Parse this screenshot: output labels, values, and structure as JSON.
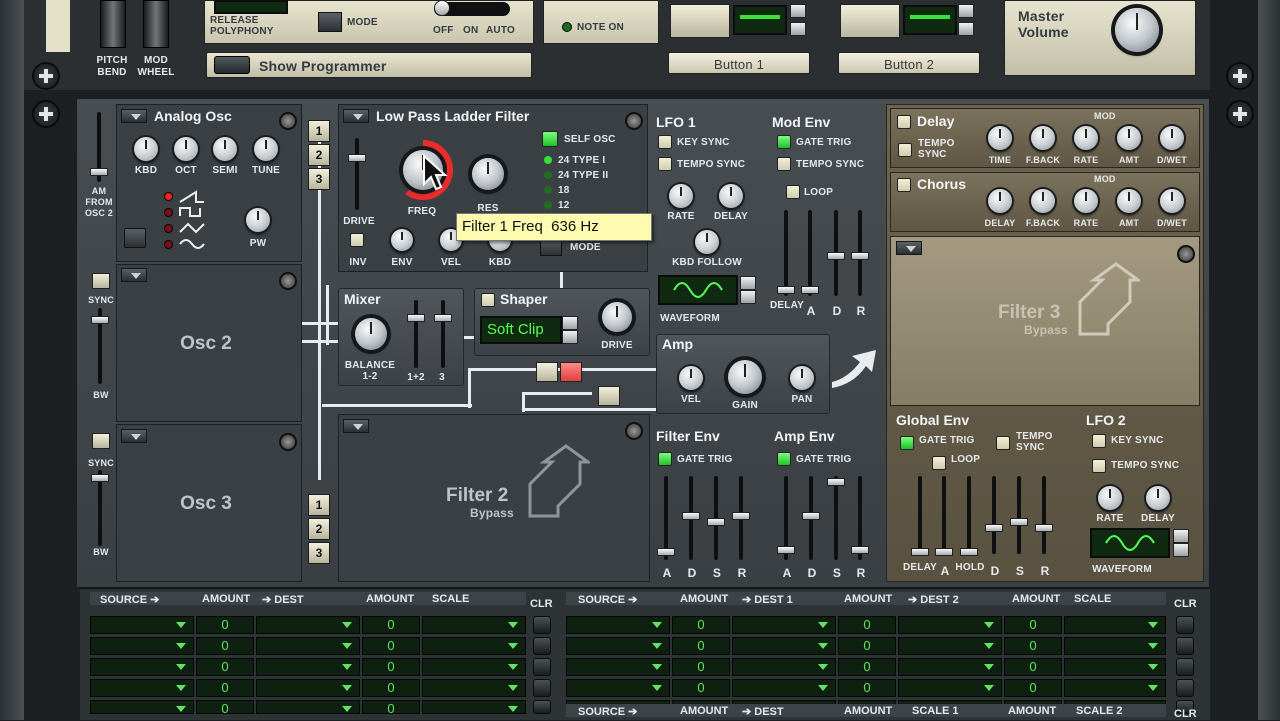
{
  "top": {
    "pitch_bend": "PITCH BEND",
    "mod_wheel": "MOD WHEEL",
    "release_polyphony": "RELEASE POLYPHONY",
    "mode": "MODE",
    "portamento_off": "OFF",
    "portamento_on": "ON",
    "portamento_auto": "AUTO",
    "note_on": "NOTE ON",
    "show_programmer": "Show Programmer",
    "button1": "Button 1",
    "button2": "Button 2",
    "master_volume": "Master Volume"
  },
  "osc1": {
    "title": "Analog Osc",
    "kbd": "KBD",
    "oct": "OCT",
    "semi": "SEMI",
    "tune": "TUNE",
    "pw": "PW",
    "am_from": "AM FROM OSC 2",
    "sync": "SYNC",
    "bw": "BW"
  },
  "osc2": {
    "title": "Osc 2",
    "sync": "SYNC",
    "bw": "BW"
  },
  "osc3": {
    "title": "Osc 3"
  },
  "filter1": {
    "title": "Low Pass Ladder Filter",
    "self_osc": "SELF OSC",
    "types": [
      "24 TYPE I",
      "24 TYPE II",
      "18",
      "12"
    ],
    "drive": "DRIVE",
    "freq": "FREQ",
    "res": "RES",
    "inv": "INV",
    "env": "ENV",
    "vel": "VEL",
    "kbd": "KBD",
    "mode": "MODE",
    "tooltip": "Filter 1 Freq  636 Hz"
  },
  "routing": {
    "n1": "1",
    "n2": "2",
    "n3": "3"
  },
  "mixer": {
    "title": "Mixer",
    "balance": "BALANCE 1-2",
    "ch12": "1+2",
    "ch3": "3"
  },
  "shaper": {
    "title": "Shaper",
    "mode": "Soft Clip",
    "drive": "DRIVE"
  },
  "filter2": {
    "title": "Filter 2",
    "bypass": "Bypass"
  },
  "filter3": {
    "title": "Filter 3",
    "bypass": "Bypass"
  },
  "amp": {
    "title": "Amp",
    "vel": "VEL",
    "gain": "GAIN",
    "pan": "PAN"
  },
  "lfo1": {
    "title": "LFO 1",
    "key_sync": "KEY SYNC",
    "tempo_sync": "TEMPO SYNC",
    "rate": "RATE",
    "delay": "DELAY",
    "kbd_follow": "KBD FOLLOW",
    "waveform": "WAVEFORM"
  },
  "mod_env": {
    "title": "Mod Env",
    "gate_trig": "GATE TRIG",
    "tempo_sync": "TEMPO SYNC",
    "loop": "LOOP",
    "delay": "DELAY",
    "a": "A",
    "d": "D",
    "r": "R"
  },
  "filter_env": {
    "title": "Filter Env",
    "gate_trig": "GATE TRIG",
    "a": "A",
    "d": "D",
    "s": "S",
    "r": "R"
  },
  "amp_env": {
    "title": "Amp Env",
    "gate_trig": "GATE TRIG",
    "a": "A",
    "d": "D",
    "s": "S",
    "r": "R"
  },
  "delay_fx": {
    "title": "Delay",
    "tempo_sync": "TEMPO SYNC",
    "time": "TIME",
    "fback": "F.BACK",
    "rate": "RATE",
    "amt": "AMT",
    "dwet": "D/WET",
    "mod": "MOD"
  },
  "chorus_fx": {
    "title": "Chorus",
    "delay": "DELAY",
    "fback": "F.BACK",
    "rate": "RATE",
    "amt": "AMT",
    "dwet": "D/WET",
    "mod": "MOD"
  },
  "global_env": {
    "title": "Global Env",
    "gate_trig": "GATE TRIG",
    "tempo_sync": "TEMPO SYNC",
    "loop": "LOOP",
    "delay": "DELAY",
    "a": "A",
    "hold": "HOLD",
    "d": "D",
    "s": "S",
    "r": "R"
  },
  "lfo2": {
    "title": "LFO 2",
    "key_sync": "KEY SYNC",
    "tempo_sync": "TEMPO SYNC",
    "rate": "RATE",
    "delay": "DELAY",
    "waveform": "WAVEFORM"
  },
  "mod_bus": {
    "left_headers": {
      "source": "SOURCE ➔",
      "amount1": "AMOUNT",
      "dest": "➔ DEST",
      "amount2": "AMOUNT",
      "scale": "SCALE"
    },
    "right_headers": {
      "source": "SOURCE ➔",
      "amount1": "AMOUNT",
      "dest1": "➔ DEST 1",
      "amount2": "AMOUNT",
      "dest2": "➔ DEST 2",
      "amount3": "AMOUNT",
      "scale": "SCALE"
    },
    "bottom_headers": {
      "source": "SOURCE ➔",
      "amount1": "AMOUNT",
      "dest": "➔ DEST",
      "amount2": "AMOUNT",
      "scale1": "SCALE 1",
      "amount3": "AMOUNT",
      "scale2": "SCALE 2"
    },
    "clr": "CLR",
    "zero": "0"
  },
  "colors": {
    "accent_green": "#38e038",
    "led_red": "#ff2020",
    "tooltip_bg": "#fdfbb0"
  }
}
